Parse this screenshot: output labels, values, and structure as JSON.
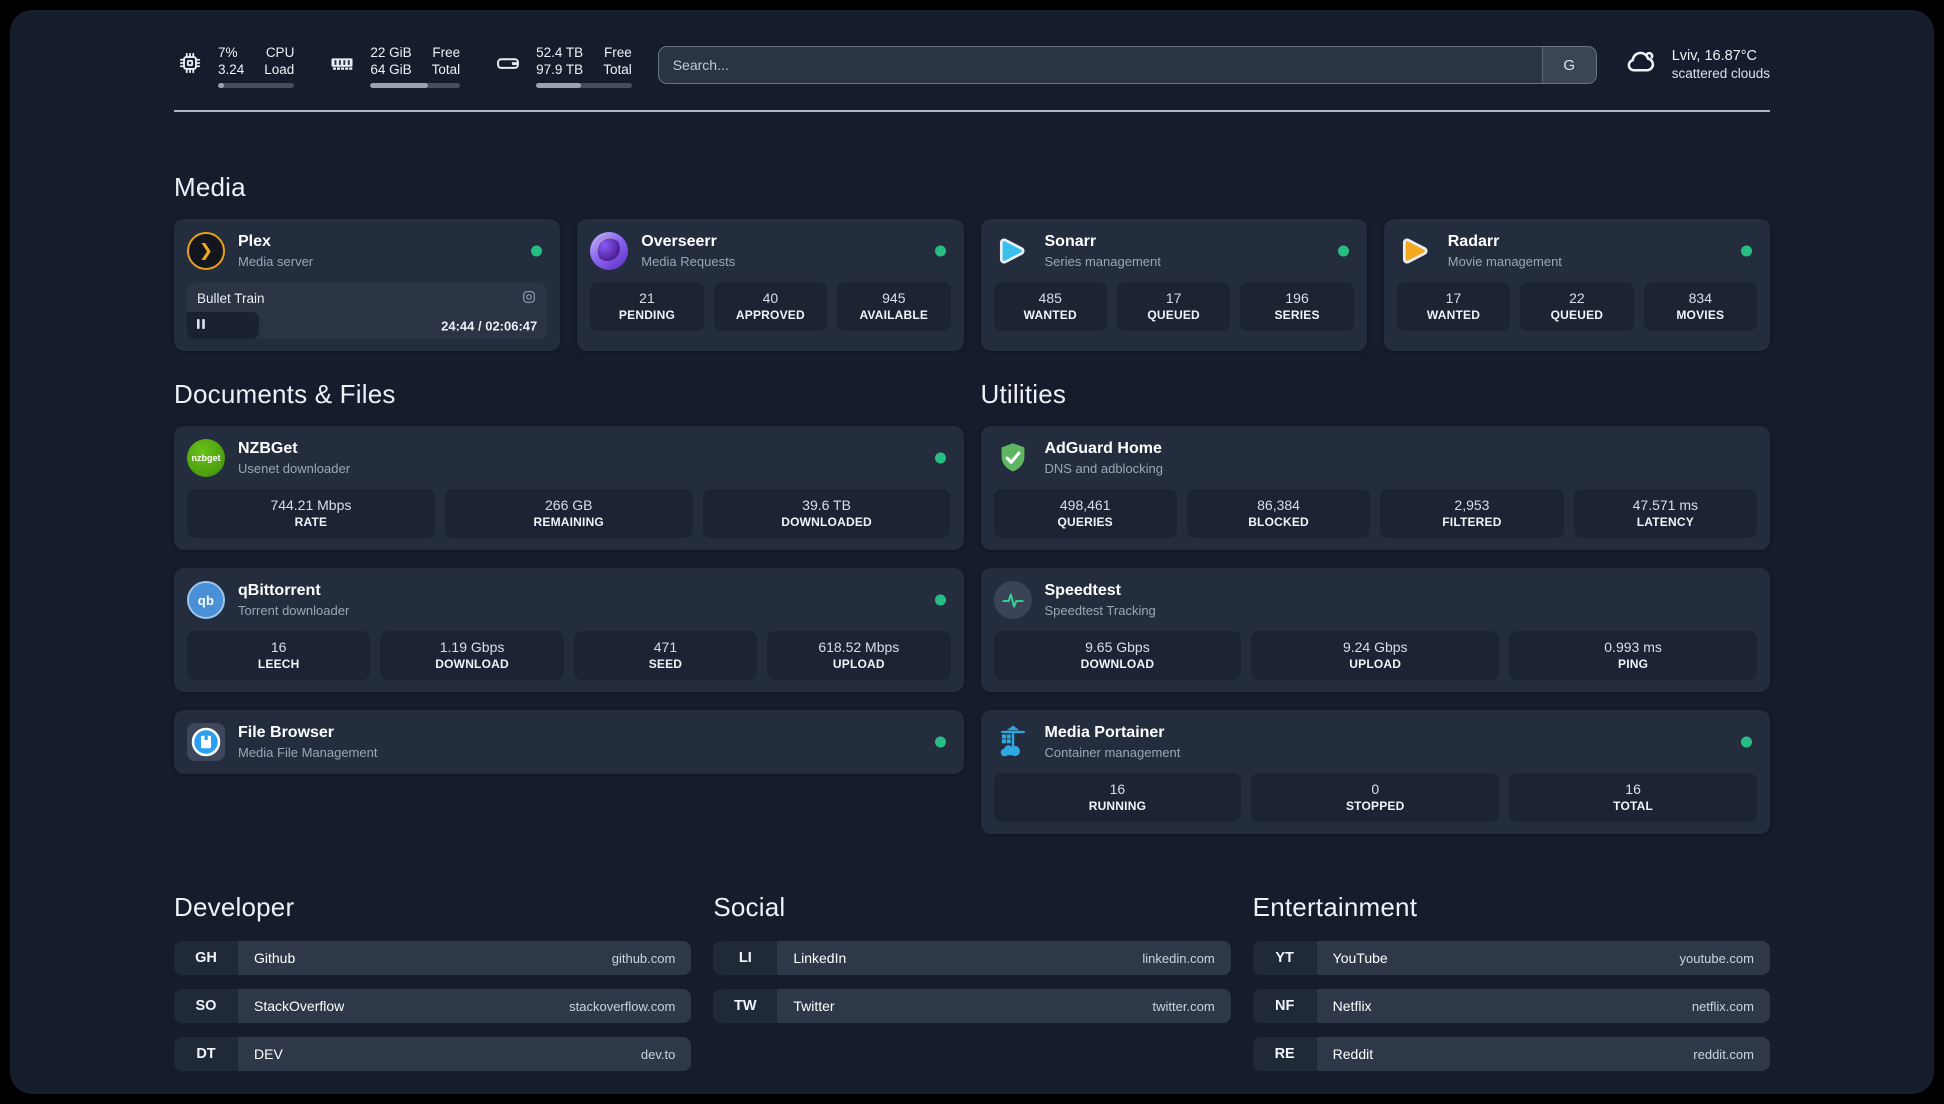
{
  "header": {
    "stats": [
      {
        "icon": "cpu-chip-icon",
        "col1_top": "7%",
        "col1_bottom": "3.24",
        "col2_top": "CPU",
        "col2_bottom": "Load",
        "progress_pct": 8
      },
      {
        "icon": "memory-icon",
        "col1_top": "22 GiB",
        "col1_bottom": "64 GiB",
        "col2_top": "Free",
        "col2_bottom": "Total",
        "progress_pct": 64
      },
      {
        "icon": "hard-drive-icon",
        "col1_top": "52.4 TB",
        "col1_bottom": "97.9 TB",
        "col2_top": "Free",
        "col2_bottom": "Total",
        "progress_pct": 47
      }
    ],
    "search": {
      "placeholder": "Search...",
      "engine_button": "G"
    },
    "weather": {
      "icon": "cloud-icon",
      "location": "Lviv, 16.87°C",
      "condition": "scattered clouds"
    }
  },
  "icons": {
    "plex_glyph": "❯",
    "nzbget_badge": "nzbget",
    "qbittorrent_badge": "qb"
  },
  "colors": {
    "status_online": "#27be84",
    "plex_amber": "#e8a117",
    "overseerr_purple": "#8f6cf5",
    "sonarr_blue": "#38c1ef",
    "radarr_amber": "#f3a81d",
    "nzbget_green": "#54a412",
    "qbittorrent_blue": "#4a90d9",
    "filebrowser_blue": "#2b9ff2",
    "adguard_green": "#5eb562",
    "speedtest_green": "#2fd792",
    "portainer_blue": "#2fa8e0"
  },
  "sections": {
    "media": {
      "title": "Media",
      "apps": [
        {
          "name": "Plex",
          "subtitle": "Media server",
          "online": true,
          "now_playing": {
            "title": "Bullet Train",
            "time": "24:44 / 02:06:47",
            "progress_pct": 20,
            "state": "paused"
          }
        },
        {
          "name": "Overseerr",
          "subtitle": "Media Requests",
          "online": true,
          "stats": [
            {
              "value": "21",
              "label": "PENDING"
            },
            {
              "value": "40",
              "label": "APPROVED"
            },
            {
              "value": "945",
              "label": "AVAILABLE"
            }
          ]
        },
        {
          "name": "Sonarr",
          "subtitle": "Series management",
          "online": true,
          "stats": [
            {
              "value": "485",
              "label": "WANTED"
            },
            {
              "value": "17",
              "label": "QUEUED"
            },
            {
              "value": "196",
              "label": "SERIES"
            }
          ]
        },
        {
          "name": "Radarr",
          "subtitle": "Movie management",
          "online": true,
          "stats": [
            {
              "value": "17",
              "label": "WANTED"
            },
            {
              "value": "22",
              "label": "QUEUED"
            },
            {
              "value": "834",
              "label": "MOVIES"
            }
          ]
        }
      ]
    },
    "documents": {
      "title": "Documents & Files",
      "apps": [
        {
          "name": "NZBGet",
          "subtitle": "Usenet downloader",
          "online": true,
          "stats": [
            {
              "value": "744.21 Mbps",
              "label": "RATE"
            },
            {
              "value": "266 GB",
              "label": "REMAINING"
            },
            {
              "value": "39.6 TB",
              "label": "DOWNLOADED"
            }
          ]
        },
        {
          "name": "qBittorrent",
          "subtitle": "Torrent downloader",
          "online": true,
          "stats": [
            {
              "value": "16",
              "label": "LEECH"
            },
            {
              "value": "1.19 Gbps",
              "label": "DOWNLOAD"
            },
            {
              "value": "471",
              "label": "SEED"
            },
            {
              "value": "618.52 Mbps",
              "label": "UPLOAD"
            }
          ]
        },
        {
          "name": "File Browser",
          "subtitle": "Media File Management",
          "online": true,
          "stats": []
        }
      ]
    },
    "utilities": {
      "title": "Utilities",
      "apps": [
        {
          "name": "AdGuard Home",
          "subtitle": "DNS and adblocking",
          "online": false,
          "stats": [
            {
              "value": "498,461",
              "label": "QUERIES"
            },
            {
              "value": "86,384",
              "label": "BLOCKED"
            },
            {
              "value": "2,953",
              "label": "FILTERED"
            },
            {
              "value": "47.571 ms",
              "label": "LATENCY"
            }
          ]
        },
        {
          "name": "Speedtest",
          "subtitle": "Speedtest Tracking",
          "online": false,
          "stats": [
            {
              "value": "9.65 Gbps",
              "label": "DOWNLOAD"
            },
            {
              "value": "9.24 Gbps",
              "label": "UPLOAD"
            },
            {
              "value": "0.993 ms",
              "label": "PING"
            }
          ]
        },
        {
          "name": "Media Portainer",
          "subtitle": "Container management",
          "online": true,
          "stats": [
            {
              "value": "16",
              "label": "RUNNING"
            },
            {
              "value": "0",
              "label": "STOPPED"
            },
            {
              "value": "16",
              "label": "TOTAL"
            }
          ]
        }
      ]
    },
    "bookmarks": [
      {
        "title": "Developer",
        "items": [
          {
            "abbr": "GH",
            "name": "Github",
            "url": "github.com"
          },
          {
            "abbr": "SO",
            "name": "StackOverflow",
            "url": "stackoverflow.com"
          },
          {
            "abbr": "DT",
            "name": "DEV",
            "url": "dev.to"
          }
        ]
      },
      {
        "title": "Social",
        "items": [
          {
            "abbr": "LI",
            "name": "LinkedIn",
            "url": "linkedin.com"
          },
          {
            "abbr": "TW",
            "name": "Twitter",
            "url": "twitter.com"
          }
        ]
      },
      {
        "title": "Entertainment",
        "items": [
          {
            "abbr": "YT",
            "name": "YouTube",
            "url": "youtube.com"
          },
          {
            "abbr": "NF",
            "name": "Netflix",
            "url": "netflix.com"
          },
          {
            "abbr": "RE",
            "name": "Reddit",
            "url": "reddit.com"
          }
        ]
      }
    ]
  }
}
